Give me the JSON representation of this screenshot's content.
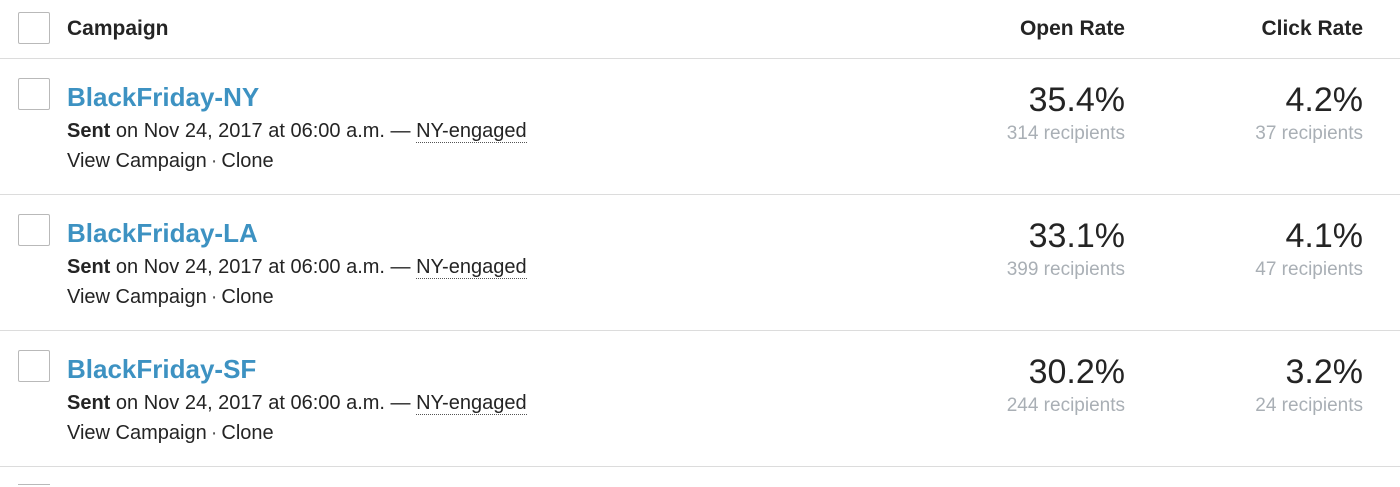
{
  "header": {
    "campaign_label": "Campaign",
    "open_rate_label": "Open Rate",
    "click_rate_label": "Click Rate"
  },
  "colors": {
    "campaign_link": "#3d92c2",
    "muted_text": "#a9afb5",
    "divider": "#dcdcdc"
  },
  "rows": [
    {
      "name": "BlackFriday-NY",
      "sent_label": "Sent",
      "sent_detail": " on Nov 24, 2017 at 06:00 a.m. — ",
      "segment": "NY-engaged",
      "view_label": "View Campaign",
      "separator": "·",
      "clone_label": "Clone",
      "open_rate": "35.4%",
      "open_recipients": "314 recipients",
      "click_rate": "4.2%",
      "click_recipients": "37 recipients"
    },
    {
      "name": "BlackFriday-LA",
      "sent_label": "Sent",
      "sent_detail": " on Nov 24, 2017 at 06:00 a.m. — ",
      "segment": "NY-engaged",
      "view_label": "View Campaign",
      "separator": "·",
      "clone_label": "Clone",
      "open_rate": "33.1%",
      "open_recipients": "399 recipients",
      "click_rate": "4.1%",
      "click_recipients": "47 recipients"
    },
    {
      "name": "BlackFriday-SF",
      "sent_label": "Sent",
      "sent_detail": " on Nov 24, 2017 at 06:00 a.m. — ",
      "segment": "NY-engaged",
      "view_label": "View Campaign",
      "separator": "·",
      "clone_label": "Clone",
      "open_rate": "30.2%",
      "open_recipients": "244 recipients",
      "click_rate": "3.2%",
      "click_recipients": "24 recipients"
    }
  ]
}
